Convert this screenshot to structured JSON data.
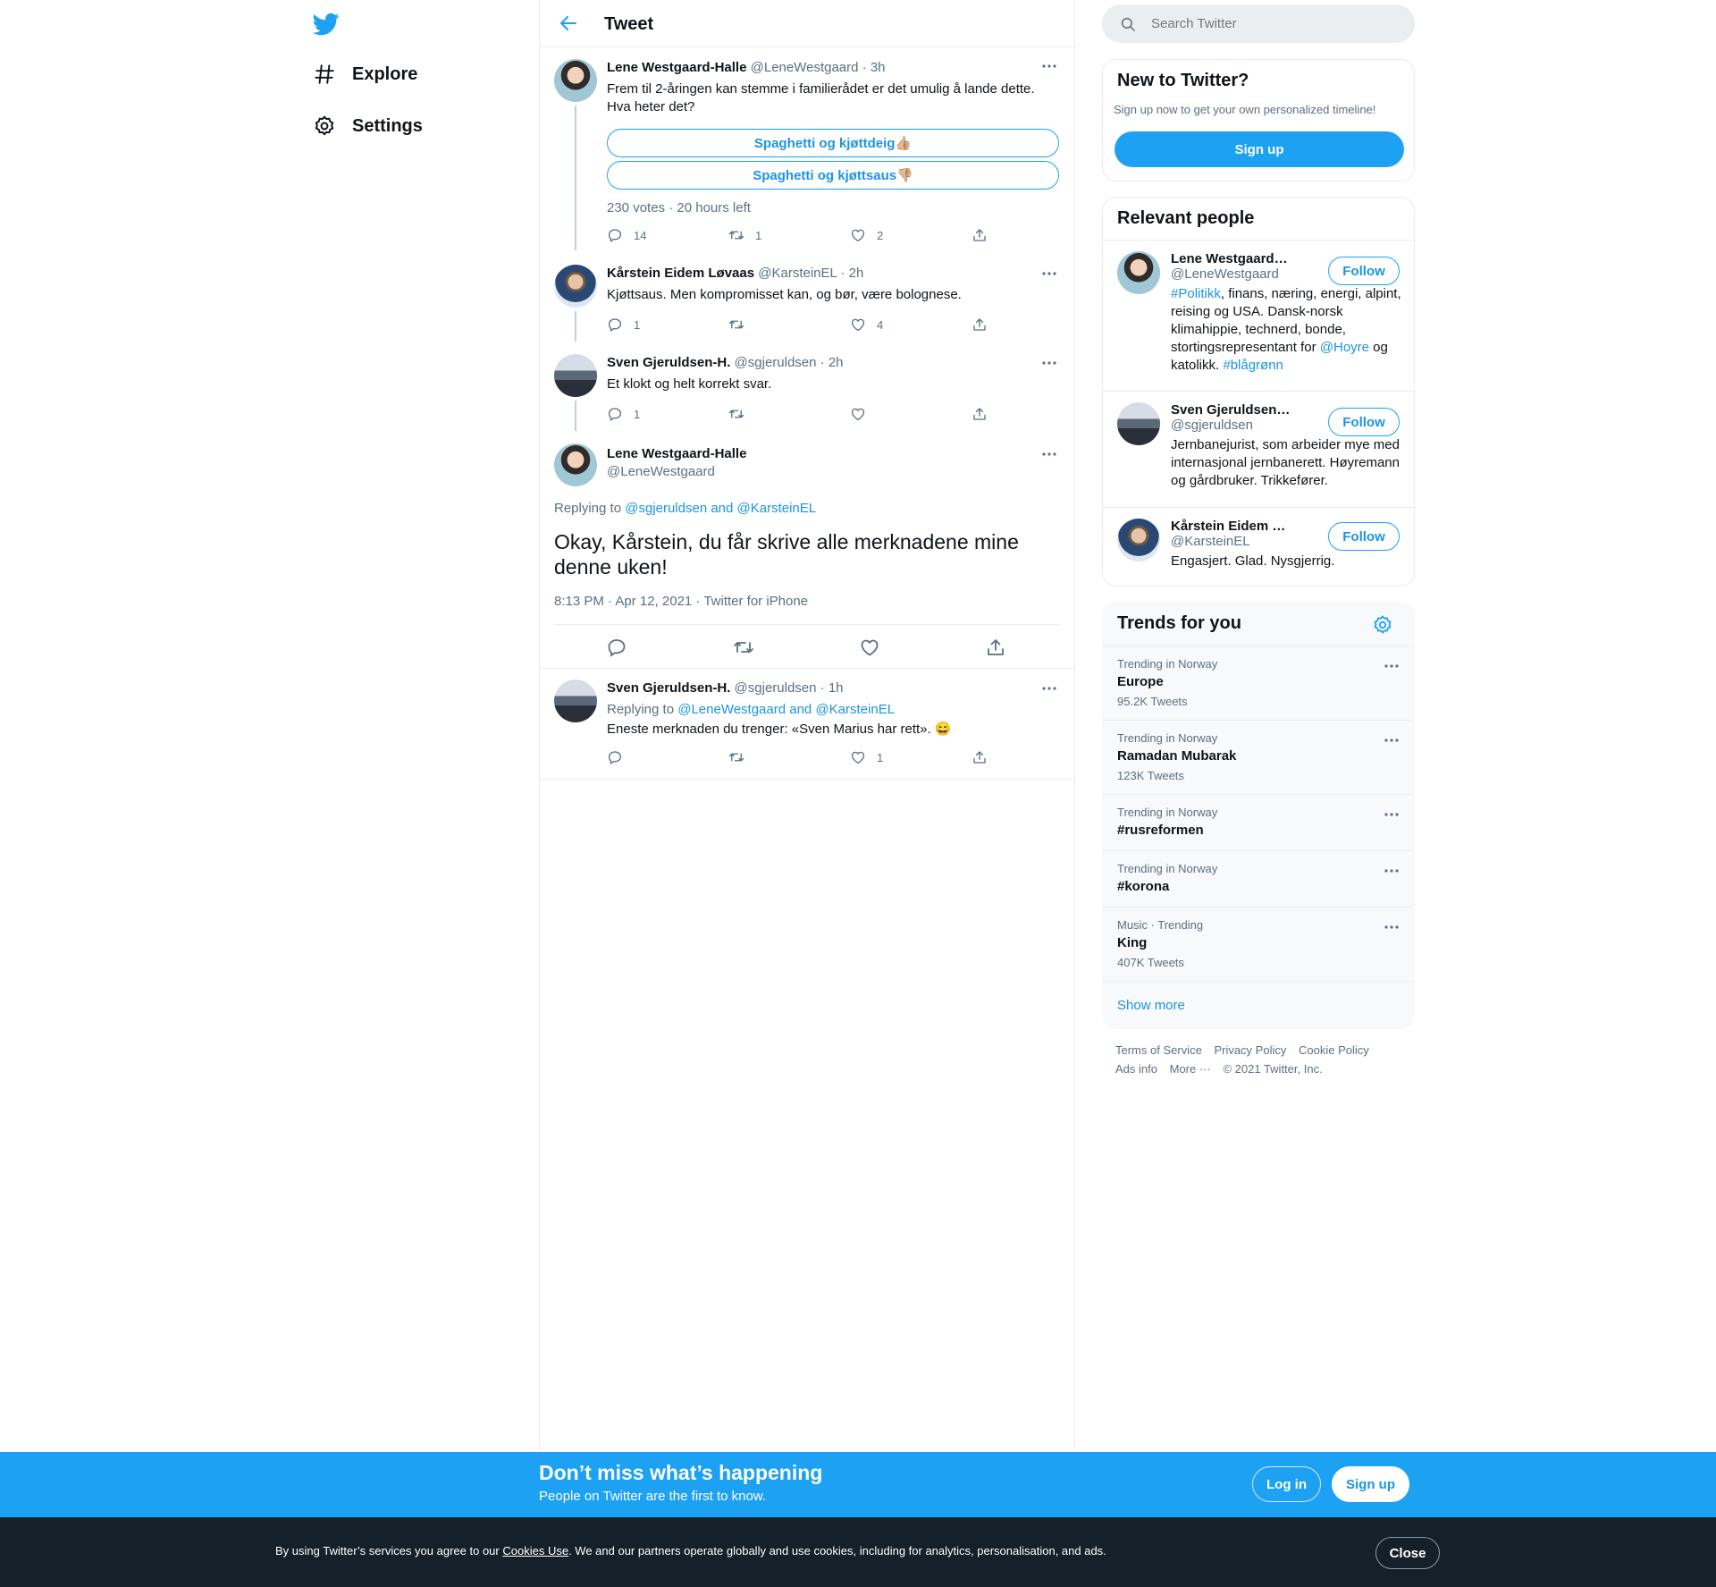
{
  "nav": {
    "explore_label": "Explore",
    "settings_label": "Settings"
  },
  "header": {
    "title": "Tweet"
  },
  "thread": [
    {
      "name": "Lene Westgaard-Halle",
      "handle": "@LeneWestgaard",
      "time": "· 3h",
      "text_line1": "Frem til 2-åringen kan stemme i familierådet er det umulig å lande dette.",
      "text_line2": "Hva heter det?",
      "poll_options": [
        "Spaghetti og kjøttdeig👍🏼",
        "Spaghetti og kjøttsaus👎🏼"
      ],
      "poll_meta": "230 votes · 20 hours left",
      "replies": "14",
      "retweets": "1",
      "likes": "2"
    },
    {
      "name": "Kårstein Eidem Løvaas",
      "handle": "@KarsteinEL",
      "time": "· 2h",
      "text": "Kjøttsaus. Men kompromisset kan, og bør, være bolognese.",
      "replies": "1",
      "retweets": "",
      "likes": "4"
    },
    {
      "name": "Sven Gjeruldsen-H.",
      "handle": "@sgjeruldsen",
      "time": "· 2h",
      "text": "Et klokt og helt korrekt svar.",
      "replies": "1",
      "retweets": "",
      "likes": ""
    }
  ],
  "focus": {
    "name": "Lene Westgaard-Halle",
    "handle": "@LeneWestgaard",
    "replying_prefix": "Replying to",
    "replying_to": "@sgjeruldsen and @KarsteinEL",
    "text": "Okay, Kårstein, du får skrive alle merknadene mine denne uken!",
    "meta": "8:13 PM · Apr 12, 2021 · Twitter for iPhone"
  },
  "reply": {
    "name": "Sven Gjeruldsen-H.",
    "handle": "@sgjeruldsen",
    "time": "· 1h",
    "replying_prefix": "Replying to",
    "replying_to": "@LeneWestgaard and @KarsteinEL",
    "text": "Eneste merknaden du trenger: «Sven Marius har rett». 😄",
    "replies": "",
    "retweets": "",
    "likes": "1"
  },
  "search": {
    "placeholder": "Search Twitter"
  },
  "new_to_twitter": {
    "title": "New to Twitter?",
    "subtitle": "Sign up now to get your own personalized timeline!",
    "signup_label": "Sign up"
  },
  "relevant_people": {
    "title": "Relevant people",
    "follow_label": "Follow",
    "people": [
      {
        "name": "Lene Westgaard-Halle",
        "handle": "@LeneWestgaard",
        "bio_1": "#Politikk",
        "bio_2": ", finans, næring, energi, alpint, reising og USA. Dansk-norsk klimahippie, technerd, bonde, stortingsrepresentant for ",
        "bio_3": "@Hoyre",
        "bio_4": " og katolikk. ",
        "bio_5": "#blågrønn"
      },
      {
        "name": "Sven Gjeruldsen-H.",
        "handle": "@sgjeruldsen",
        "bio": "Jernbanejurist, som arbeider mye med internasjonal jernbanerett. Høyremann og gårdbruker. Trikkefører."
      },
      {
        "name": "Kårstein Eidem Løvaas",
        "handle": "@KarsteinEL",
        "bio": "Engasjert. Glad. Nysgjerrig."
      }
    ]
  },
  "trends": {
    "title": "Trends for you",
    "items": [
      {
        "context": "Trending in Norway",
        "name": "Europe",
        "count": "95.2K Tweets"
      },
      {
        "context": "Trending in Norway",
        "name": "Ramadan Mubarak",
        "count": "123K Tweets"
      },
      {
        "context": "Trending in Norway",
        "name": "#rusreformen",
        "count": ""
      },
      {
        "context": "Trending in Norway",
        "name": "#korona",
        "count": ""
      },
      {
        "context": "Music · Trending",
        "name": "King",
        "count": "407K Tweets"
      }
    ],
    "show_more": "Show more"
  },
  "footer": {
    "terms": "Terms of Service",
    "privacy": "Privacy Policy",
    "cookie": "Cookie Policy",
    "ads": "Ads info",
    "more": "More ···",
    "copyright": "© 2021 Twitter, Inc."
  },
  "bottom_bar": {
    "title": "Don’t miss what’s happening",
    "subtitle": "People on Twitter are the first to know.",
    "login_label": "Log in",
    "signup_label": "Sign up"
  },
  "cookie_bar": {
    "text_before": "By using Twitter’s services you agree to our ",
    "link": "Cookies Use",
    "text_after": ". We and our partners operate globally and use cookies, including for analytics, personalisation, and ads.",
    "close_label": "Close"
  },
  "colors": {
    "accent": "#1da1f2",
    "link": "#1b95e0",
    "text_secondary": "#5b7083",
    "cookie_bg": "#15202b"
  }
}
